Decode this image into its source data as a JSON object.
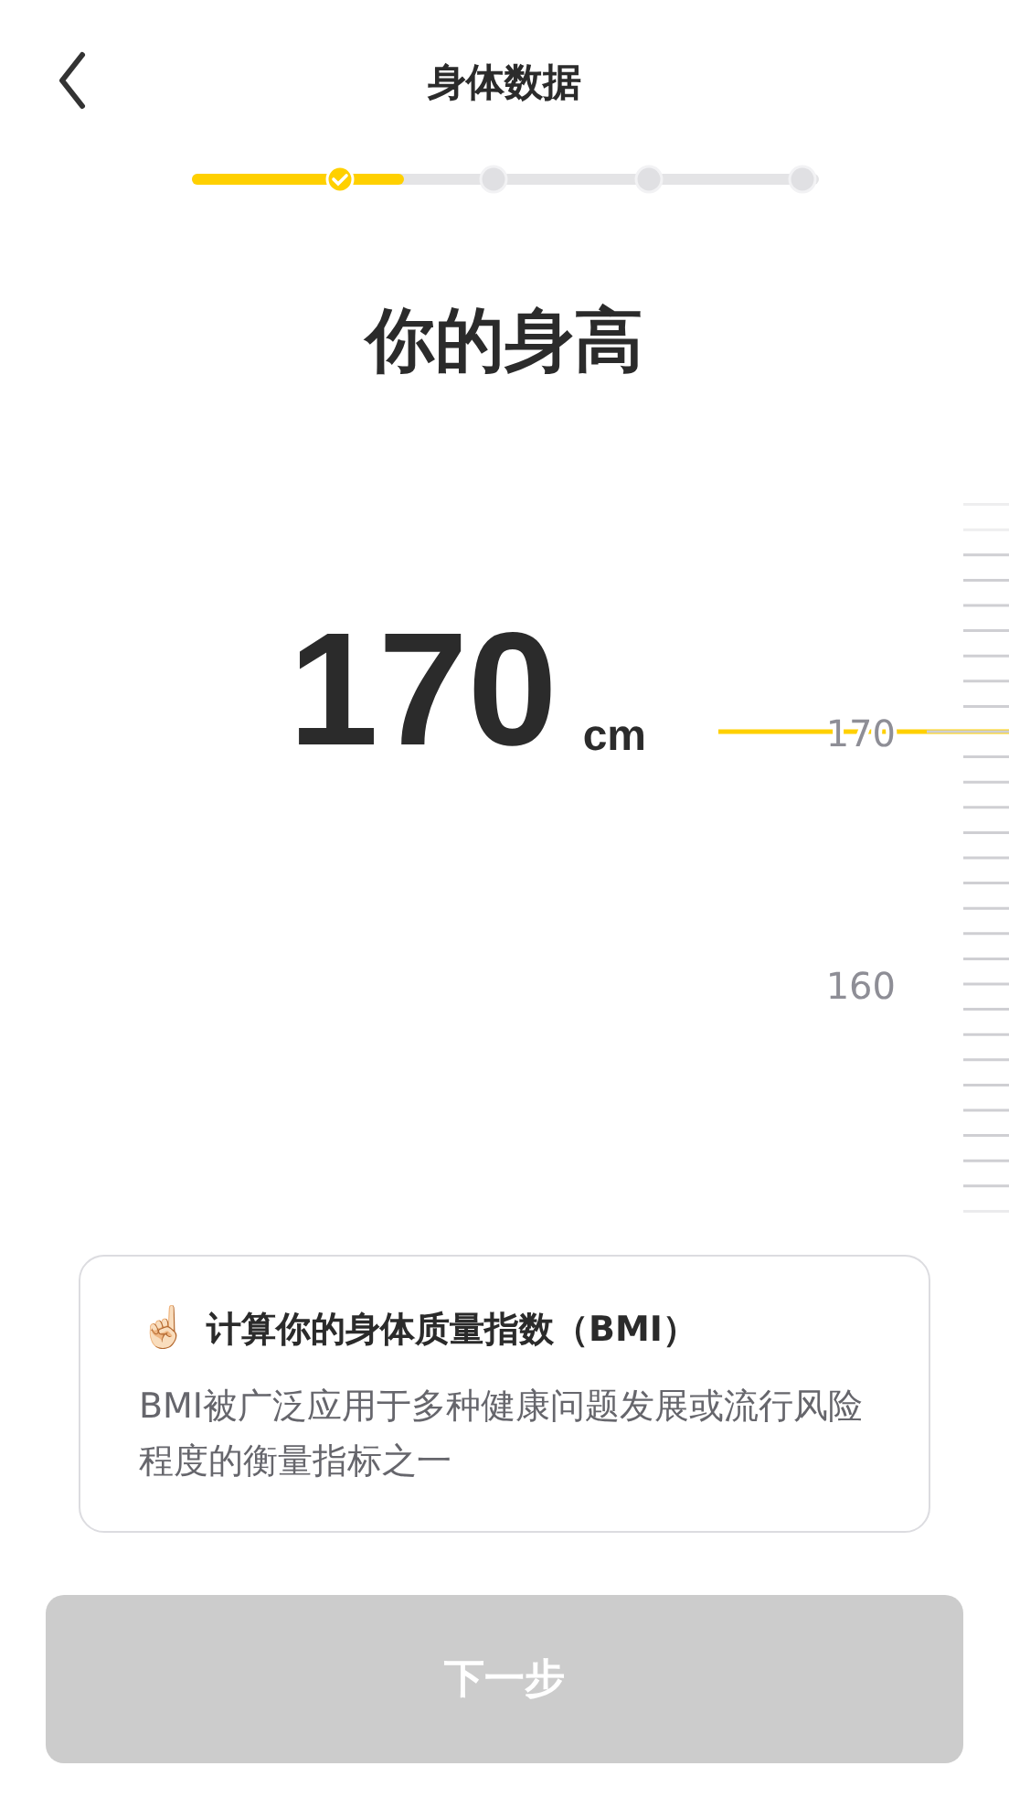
{
  "header": {
    "title": "身体数据"
  },
  "progress": {
    "level": 0.34,
    "steps": [
      {
        "done": true
      },
      {
        "done": false
      },
      {
        "done": false
      },
      {
        "done": false
      }
    ]
  },
  "question": "你的身高",
  "value": {
    "number": "170",
    "unit": "cm"
  },
  "ruler": {
    "labels": [
      "170",
      "160"
    ]
  },
  "info": {
    "emoji": "☝🏻",
    "title": "计算你的身体质量指数（BMI）",
    "text": "BMI被广泛应用于多种健康问题发展或流行风险程度的衡量指标之一"
  },
  "next_button": {
    "label": "下一步",
    "disabled": true
  }
}
